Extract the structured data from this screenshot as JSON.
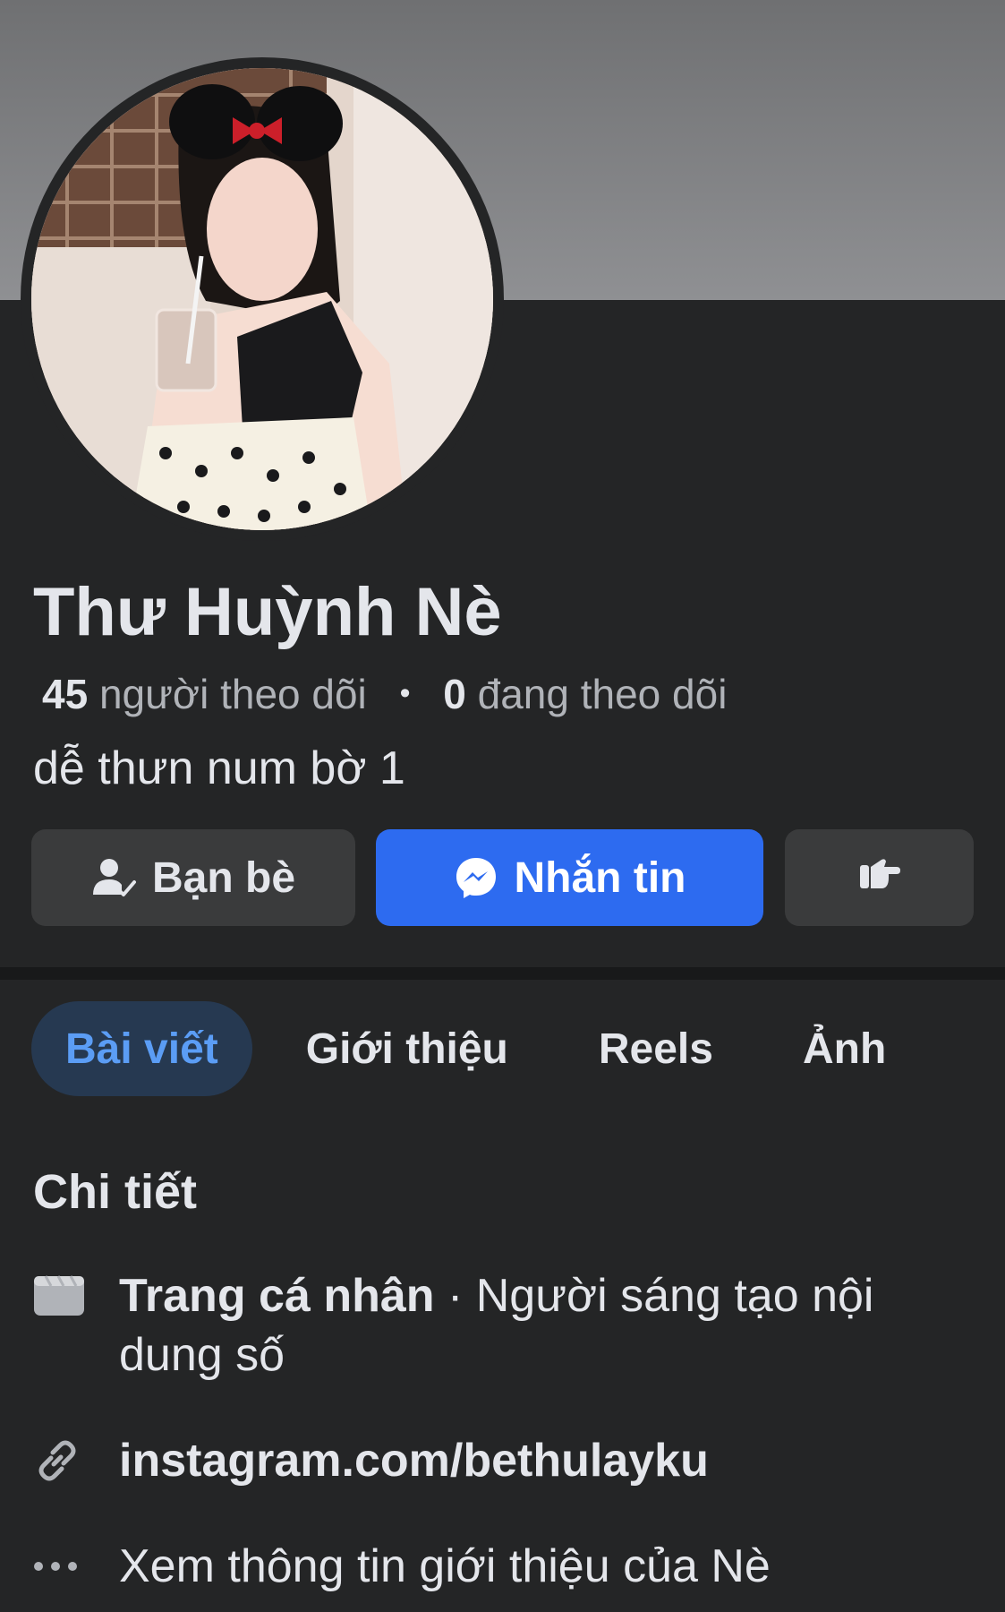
{
  "profile": {
    "name": "Thư Huỳnh Nè",
    "followers_count": "45",
    "followers_label": "người theo dõi",
    "separator": "•",
    "following_count": "0",
    "following_label": "đang theo dõi",
    "bio": "dễ thưn num bờ 1"
  },
  "actions": {
    "friends_label": "Bạn bè",
    "message_label": "Nhắn tin"
  },
  "tabs": [
    {
      "label": "Bài viết",
      "active": true
    },
    {
      "label": "Giới thiệu",
      "active": false
    },
    {
      "label": "Reels",
      "active": false
    },
    {
      "label": "Ảnh",
      "active": false
    }
  ],
  "details": {
    "title": "Chi tiết",
    "page_type_label": "Trang cá nhân",
    "page_type_separator": " · ",
    "page_category": "Người sáng tạo nội dung số",
    "link": "instagram.com/bethulayku",
    "see_about": "Xem thông tin giới thiệu của Nè"
  },
  "icons": {
    "friends": "person-check-icon",
    "message": "messenger-icon",
    "more": "pointing-hand-icon",
    "page_type": "clapperboard-icon",
    "link": "link-icon",
    "see_about": "more-dots-icon"
  },
  "colors": {
    "background": "#242526",
    "primary_button": "#2d6bf0",
    "secondary_button": "#3a3b3c",
    "active_tab_bg": "#263951",
    "active_tab_text": "#5b9df5",
    "text_primary": "#e4e6eb",
    "text_secondary": "#b0b3b8"
  }
}
